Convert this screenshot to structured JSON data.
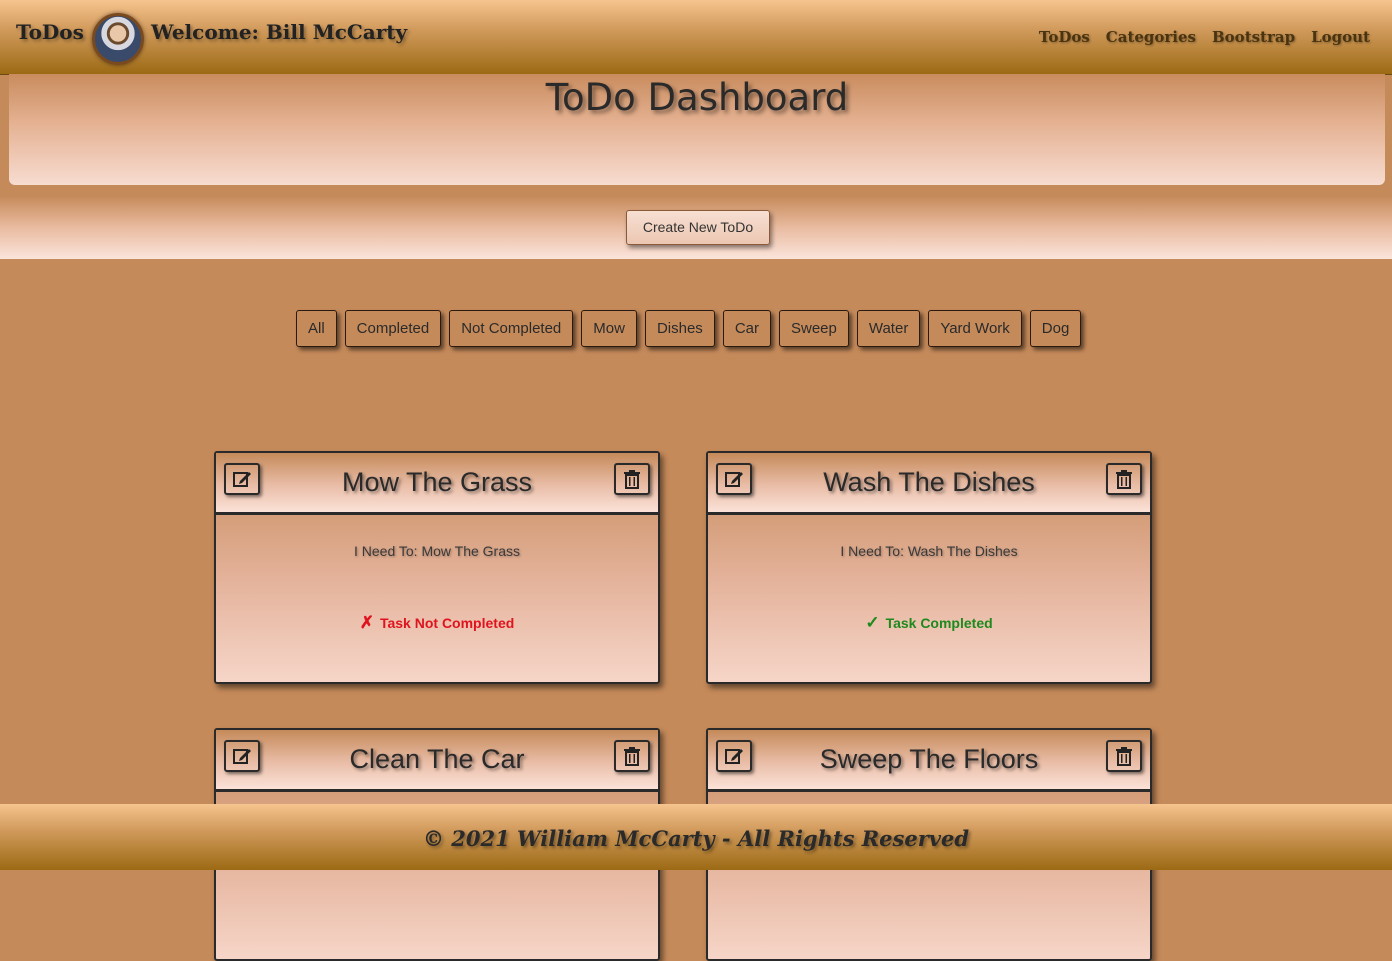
{
  "navbar": {
    "brand": "ToDos",
    "welcome": "Welcome: Bill McCarty",
    "links": [
      "ToDos",
      "Categories",
      "Bootstrap",
      "Logout"
    ]
  },
  "jumbotron": {
    "title": "ToDo Dashboard"
  },
  "create_button": "Create New ToDo",
  "filters": [
    "All",
    "Completed",
    "Not Completed",
    "Mow",
    "Dishes",
    "Car",
    "Sweep",
    "Water",
    "Yard Work",
    "Dog"
  ],
  "cards": [
    {
      "title": "Mow The Grass",
      "description": "I Need To: Mow The Grass",
      "status": "Task Not Completed",
      "status_icon": "✗",
      "status_color": "#e0141e"
    },
    {
      "title": "Wash The Dishes",
      "description": "I Need To: Wash The Dishes",
      "status": "Task Completed",
      "status_icon": "✓",
      "status_color": "#1e8a1e"
    },
    {
      "title": "Clean The Car"
    },
    {
      "title": "Sweep The Floors"
    }
  ],
  "icons": {
    "edit": "edit-icon",
    "delete": "trash-icon"
  },
  "footer": {
    "text": "© 2021 William McCarty - All Rights Reserved"
  }
}
